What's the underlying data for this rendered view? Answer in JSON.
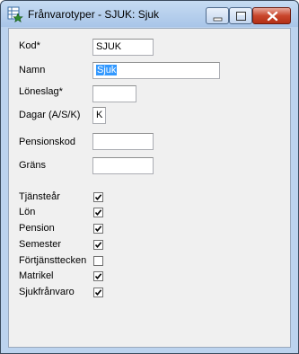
{
  "window": {
    "title": "Frånvarotyper - SJUK: Sjuk"
  },
  "icons": {
    "app": "spreadsheet-star-icon",
    "minimize": "minimize-icon",
    "maximize": "maximize-icon",
    "close": "close-icon",
    "check": "checkmark-icon"
  },
  "form": {
    "kod_label": "Kod*",
    "kod_value": "SJUK",
    "namn_label": "Namn",
    "namn_value": "Sjuk",
    "loneslag_label": "Löneslag*",
    "loneslag_value": "",
    "dagar_label": "Dagar (A/S/K)",
    "dagar_value": "K",
    "pensionskod_label": "Pensionskod",
    "pensionskod_value": "",
    "grans_label": "Gräns",
    "grans_value": ""
  },
  "checkboxes": [
    {
      "label": "Tjänsteår",
      "checked": true
    },
    {
      "label": "Lön",
      "checked": true
    },
    {
      "label": "Pension",
      "checked": true
    },
    {
      "label": "Semester",
      "checked": true
    },
    {
      "label": "Förtjänsttecken",
      "checked": false
    },
    {
      "label": "Matrikel",
      "checked": true
    },
    {
      "label": "Sjukfrånvaro",
      "checked": true
    }
  ]
}
